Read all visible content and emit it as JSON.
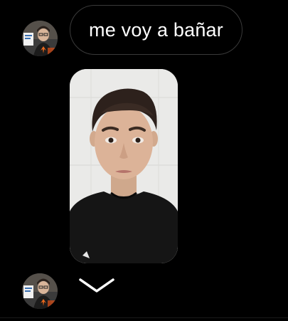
{
  "messages": [
    {
      "type": "text",
      "text": "me voy a bañar"
    },
    {
      "type": "photo",
      "content": "selfie-photo"
    }
  ],
  "icons": {
    "avatar": "sender-avatar",
    "collapse": "chevron-down-icon"
  },
  "colors": {
    "background": "#000000",
    "bubble_border": "#3a3a3a",
    "text": "#ffffff"
  }
}
